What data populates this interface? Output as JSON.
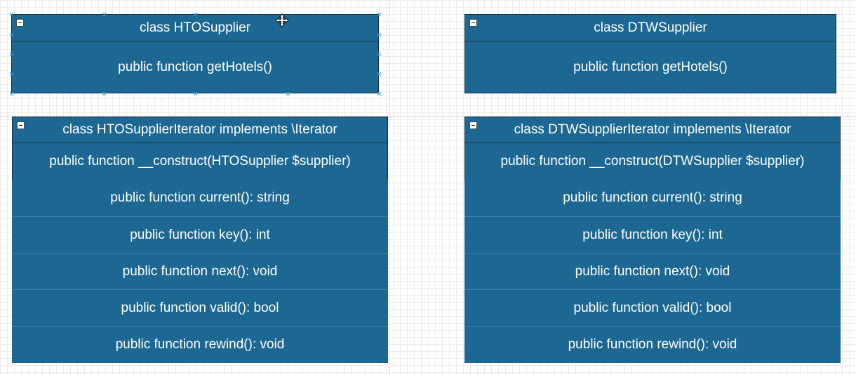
{
  "classes": {
    "hto_supplier": {
      "header": "class HTOSupplier",
      "methods": [
        "public function getHotels()"
      ]
    },
    "dtw_supplier": {
      "header": "class DTWSupplier",
      "methods": [
        "public function getHotels()"
      ]
    },
    "hto_iterator": {
      "header": "class HTOSupplierIterator implements \\Iterator",
      "methods": [
        "public function __construct(HTOSupplier $supplier)",
        "public function current(): string",
        "public function key(): int",
        "public function next(): void",
        "public function valid(): bool",
        "public function rewind(): void"
      ]
    },
    "dtw_iterator": {
      "header": "class DTWSupplierIterator implements \\Iterator",
      "methods": [
        "public function __construct(DTWSupplier $supplier)",
        "public function current(): string",
        "public function key(): int",
        "public function next(): void",
        "public function valid(): bool",
        "public function rewind(): void"
      ]
    }
  },
  "icons": {
    "collapse": "collapse-icon",
    "cursor": "move-cursor-icon"
  },
  "colors": {
    "class_fill": "#1d6893",
    "class_border": "#0f2f45",
    "selection": "#3aa3e0"
  }
}
